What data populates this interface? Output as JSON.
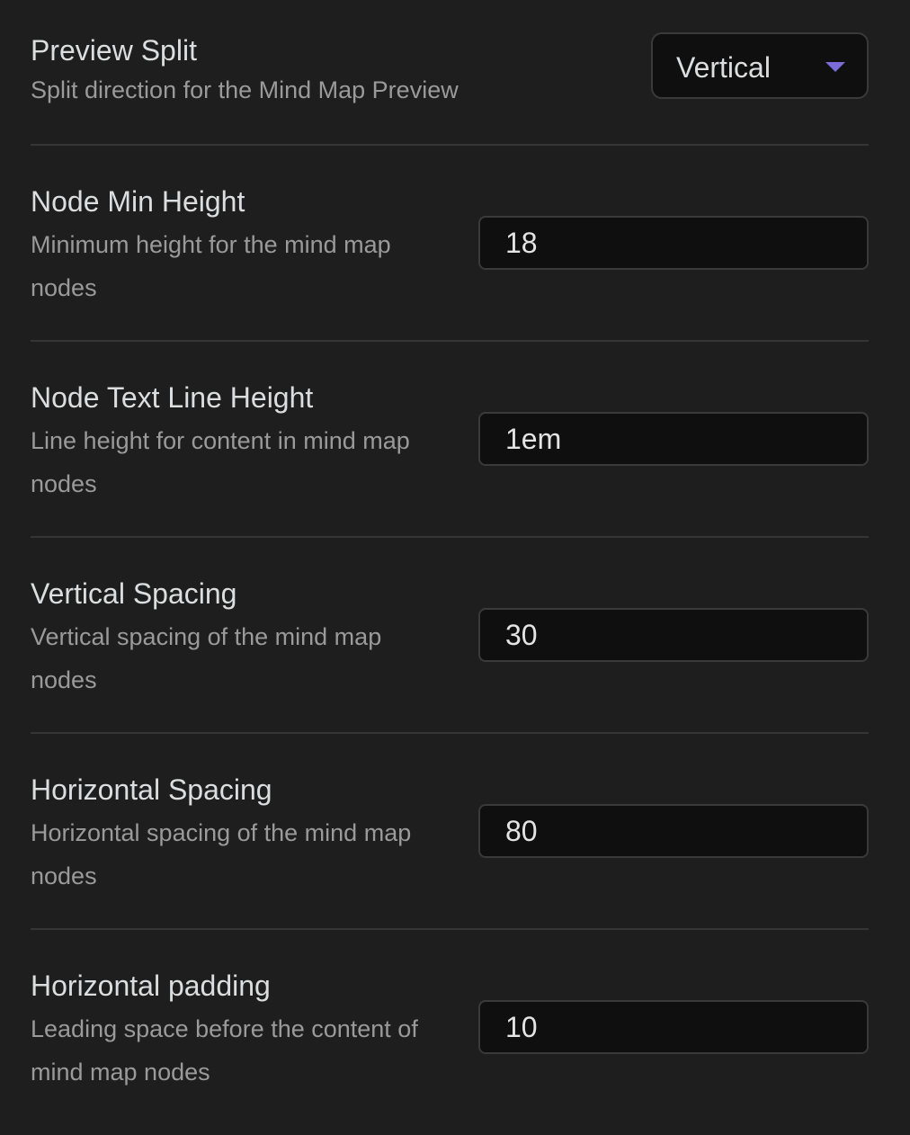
{
  "settings": [
    {
      "name": "Preview Split",
      "description": "Split direction for the Mind Map Preview",
      "control": "dropdown",
      "value": "Vertical"
    },
    {
      "name": "Node Min Height",
      "description": "Minimum height for the mind map nodes",
      "control": "text",
      "value": "18"
    },
    {
      "name": "Node Text Line Height",
      "description": "Line height for content in mind map nodes",
      "control": "text",
      "value": "1em"
    },
    {
      "name": "Vertical Spacing",
      "description": "Vertical spacing of the mind map nodes",
      "control": "text",
      "value": "30"
    },
    {
      "name": "Horizontal Spacing",
      "description": "Horizontal spacing of the mind map nodes",
      "control": "text",
      "value": "80"
    },
    {
      "name": "Horizontal padding",
      "description": "Leading space before the content of mind map nodes",
      "control": "text",
      "value": "10"
    }
  ],
  "colors": {
    "background": "#1e1e1e",
    "input_background": "#0f0f0f",
    "border": "#3a3a3a",
    "divider": "#363636",
    "accent": "#7b6cd9"
  },
  "icons": {
    "dropdown": "chevron-down-icon"
  }
}
